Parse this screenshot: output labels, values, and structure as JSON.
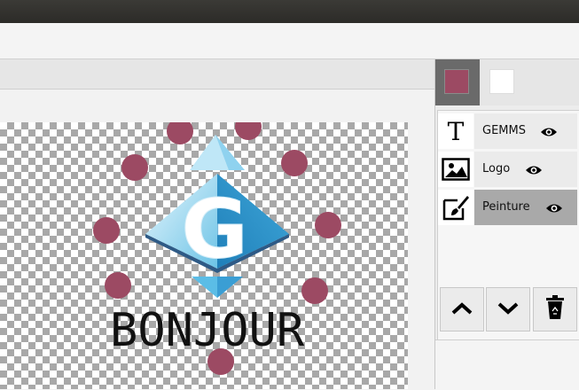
{
  "colors": {
    "primary": "#9c4a63",
    "secondary": "#ffffff",
    "accent_selected": "#6a6a6a"
  },
  "canvas": {
    "text": "BONJOUR",
    "dot_color": "#9c4a63"
  },
  "layers": [
    {
      "name": "GEMMS",
      "icon": "text-icon",
      "visible": true,
      "selected": false
    },
    {
      "name": "Logo",
      "icon": "image-icon",
      "visible": true,
      "selected": false
    },
    {
      "name": "Peinture",
      "icon": "brush-icon",
      "visible": true,
      "selected": true
    }
  ],
  "layer_buttons": [
    "move-up-icon",
    "move-down-icon",
    "trash-icon"
  ]
}
